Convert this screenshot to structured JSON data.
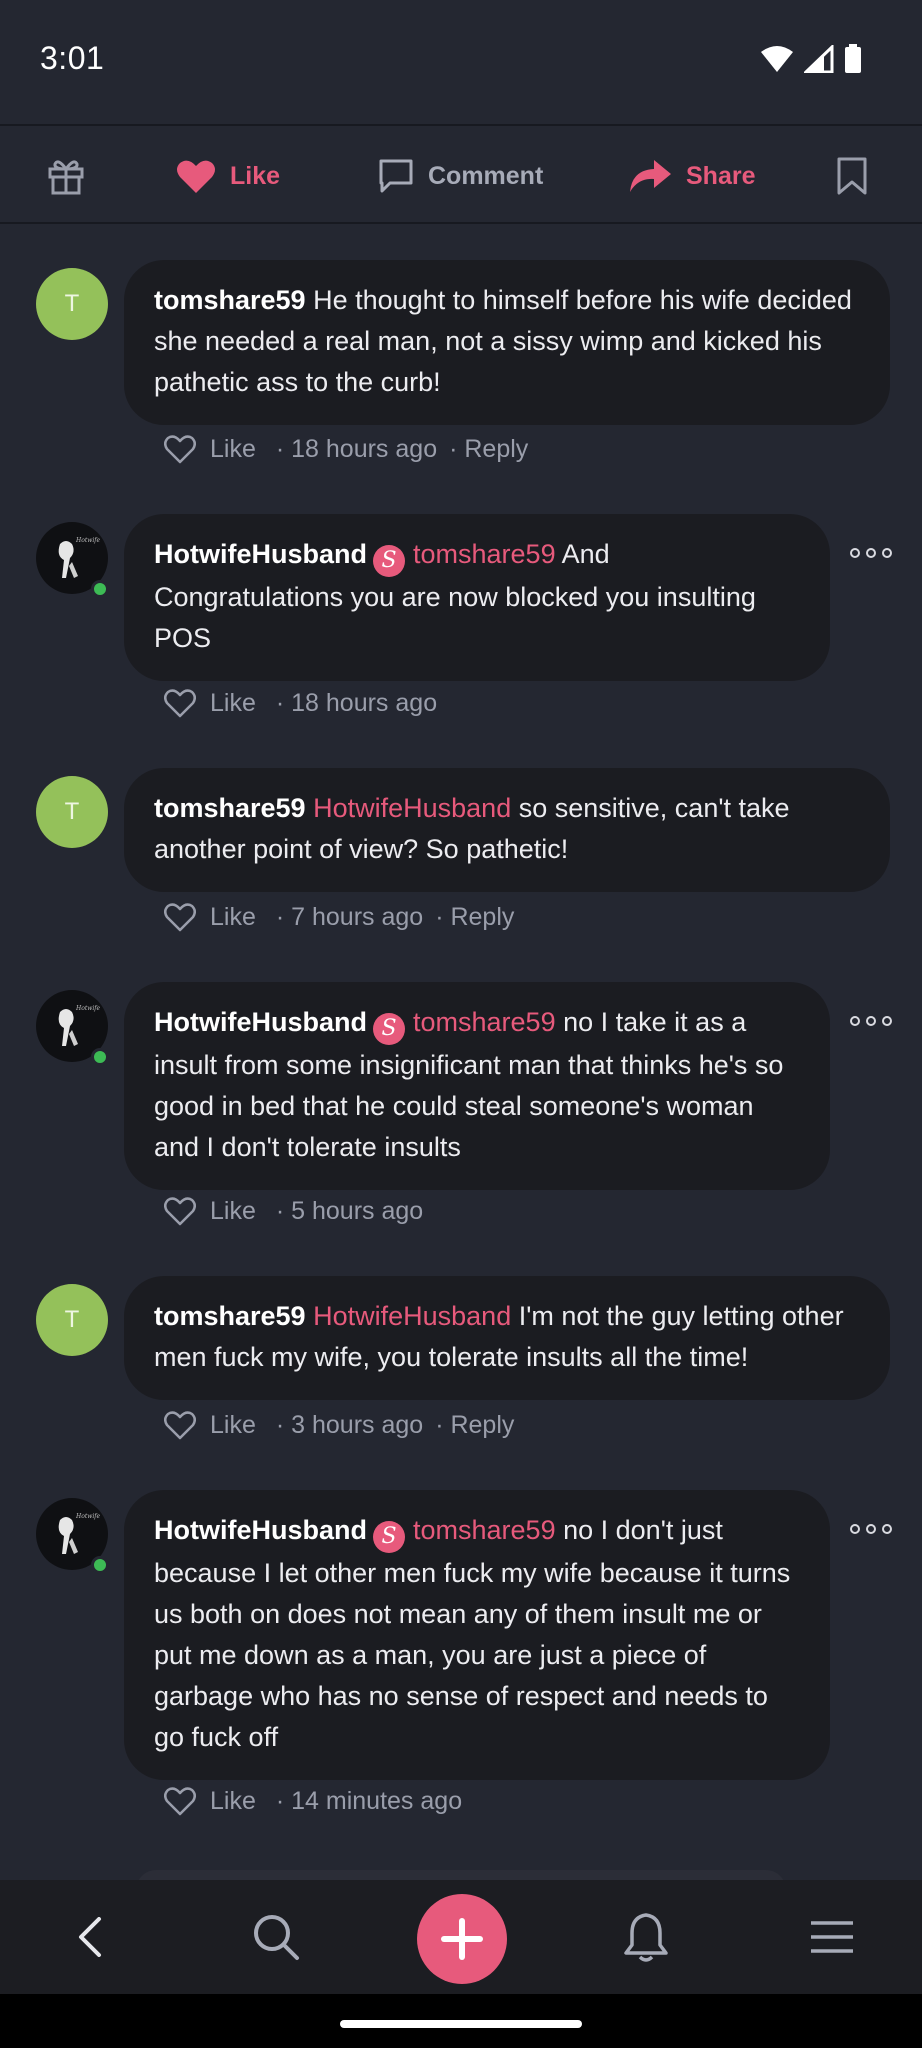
{
  "status_bar": {
    "time": "3:01",
    "icons": [
      "wifi-icon",
      "signal-icon",
      "battery-icon"
    ]
  },
  "actions": {
    "like_label": "Like",
    "comment_label": "Comment",
    "share_label": "Share"
  },
  "comments": [
    {
      "author": "tomshare59",
      "avatar_letter": "T",
      "mention": "",
      "text": "He thought to himself before his wife decided she needed a real man, not a sissy wimp and kicked his pathetic ass to the curb!",
      "like_label": "Like",
      "time": "· 18 hours ago",
      "reply": "· Reply"
    },
    {
      "author": "HotwifeHusband",
      "mention": "tomshare59",
      "text": "And Congratulations you are now blocked you insulting POS",
      "like_label": "Like",
      "time": "· 18 hours ago"
    },
    {
      "author": "tomshare59",
      "avatar_letter": "T",
      "mention": "HotwifeHusband",
      "text": "so sensitive, can't take another point of view? So pathetic!",
      "like_label": "Like",
      "time": "· 7 hours ago",
      "reply": "· Reply"
    },
    {
      "author": "HotwifeHusband",
      "mention": "tomshare59",
      "text": "no I take it as a insult from some insignificant man that thinks he's so good in bed that he could steal someone's woman and I don't tolerate insults",
      "like_label": "Like",
      "time": "· 5 hours ago"
    },
    {
      "author": "tomshare59",
      "avatar_letter": "T",
      "mention": "HotwifeHusband",
      "text": "I'm not the guy letting other men fuck my wife, you tolerate insults all the time!",
      "like_label": "Like",
      "time": "· 3 hours ago",
      "reply": "· Reply"
    },
    {
      "author": "HotwifeHusband",
      "mention": "tomshare59",
      "text": "no I don't just because I let other men fuck my wife because it turns us both on does not mean any of them insult me or put me down as a man, you are just a piece of garbage who has no sense of respect and needs to go fuck off",
      "like_label": "Like",
      "time": "· 14 minutes ago"
    }
  ],
  "colors": {
    "background": "#242731",
    "bubble": "#1b1c21",
    "accent": "#e75a7c",
    "avatar_green": "#94c15a",
    "online": "#3dbb55",
    "muted_text": "#9a9eab"
  },
  "bottom_nav": {
    "icons": [
      "back-icon",
      "search-icon",
      "plus-icon",
      "bell-icon",
      "menu-icon"
    ]
  }
}
